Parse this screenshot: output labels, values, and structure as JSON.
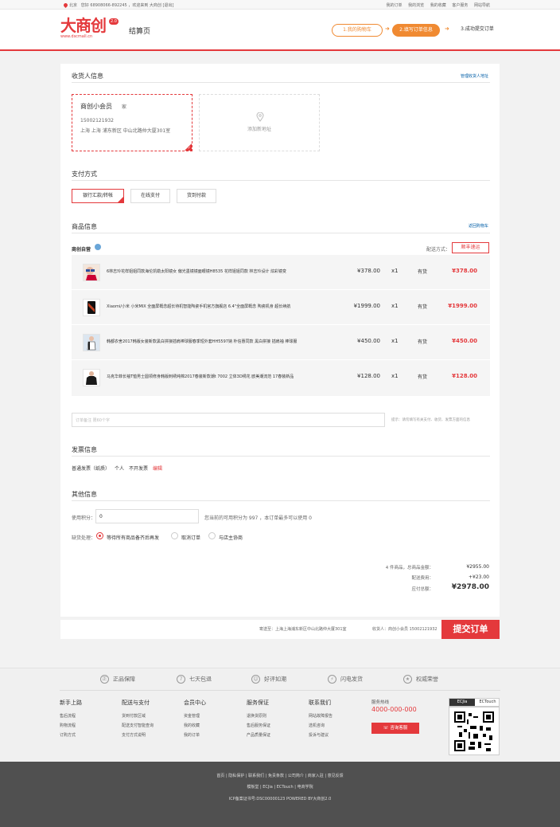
{
  "topbar": {
    "location": "北京",
    "greeting": "您好 68908066-892245 ，欢迎来到 大商创 [退出]",
    "links": [
      "我的订单",
      "我的浏览",
      "我的收藏",
      "客户服务",
      "网站导航"
    ]
  },
  "header": {
    "logo_text": "大商创",
    "logo_badge": "2.0",
    "logo_sub": "www.dscmall.cn",
    "page_title": "结算页",
    "steps": [
      "1.我的购物车",
      "2.填写订单信息",
      "3.成功提交订单"
    ]
  },
  "consignee": {
    "title": "收货人信息",
    "manage_link": "管理收货人地址",
    "name": "商创小会员",
    "tag": "家",
    "phone": "15002121932",
    "address": "上海 上海 浦东新区  中山北路仲大厦301室",
    "add_new": "添加新地址"
  },
  "payment": {
    "title": "支付方式",
    "options": [
      "银行汇款/转帐",
      "在线支付",
      "货到付款"
    ]
  },
  "goods": {
    "title": "商品信息",
    "back_link": "返回购物车",
    "shop_name": "商创自营",
    "shipping_label": "配送方式：",
    "shipping_value": "顺丰速运",
    "items": [
      {
        "name": "6林志玲花样姐姐同款海伦凯勒太阳镜女 偏光墨镜镜面眼镜H8535 花样姐姐同款 林志玲设计 炫彩镜变",
        "price": "¥378.00",
        "qty": "x1",
        "stock": "有货",
        "subtotal": "¥378.00"
      },
      {
        "name": "Xiaomi/小米 小米MIX 全面屏概念超长待机智能陶瓷手机官方旗舰店 6.4\"全面屏概念 陶瓷机身 超长续航",
        "price": "¥1999.00",
        "qty": "x1",
        "stock": "有货",
        "subtotal": "¥1999.00"
      },
      {
        "name": "韩都衣舍2017韩版女装新款黑白拼接插肩棒球服春季短外套HH5597妠 朴信惠同款 黑白拼接 插肩袖 棒球服",
        "price": "¥450.00",
        "qty": "x1",
        "stock": "有货",
        "subtotal": "¥450.00"
      },
      {
        "name": "马克华菲长袖T恤男士圆领修身韩版刺绣纯棉2017春装新款潮t 7002 立体3D绣花 欧美潮流范 17春装新品",
        "price": "¥128.00",
        "qty": "x1",
        "stock": "有货",
        "subtotal": "¥128.00"
      }
    ]
  },
  "remark": {
    "placeholder": "订单备注 限60个字",
    "hint": "提示：请勿填写有关支付、收货、发票方面的信息"
  },
  "invoice": {
    "title": "发票信息",
    "type": "普通发票（纸质）",
    "who": "个人",
    "content": "不开发票",
    "edit": "编辑"
  },
  "other": {
    "title": "其他信息",
    "points_label": "使用积分：",
    "points_value": "0",
    "points_hint": "您当前的可用积分为 997 ，本订单最多可以使用 0",
    "shortage_label": "缺货处理：",
    "shortage_options": [
      "等待所有商品备齐后再发",
      "取消订单",
      "与店主协商"
    ]
  },
  "summary": {
    "items_label": "4 件商品，总商品金额：",
    "items_value": "¥2955.00",
    "shipping_label": "配送费用：",
    "shipping_value": "+¥23.00",
    "total_label": "应付总额：",
    "total_value": "¥2978.00"
  },
  "submit": {
    "ship_to": "寄送至：上海上海浦东新区中山北路仲大厦301室",
    "receiver": "收货人：商创小会员  15002121932",
    "button": "提交订单"
  },
  "footer": {
    "assurances": [
      "正品保障",
      "七天包退",
      "好评如潮",
      "闪电发货",
      "权威荣誉"
    ],
    "columns": [
      {
        "title": "新手上路",
        "links": [
          "售后流程",
          "购物流程",
          "订购方式"
        ]
      },
      {
        "title": "配送与支付",
        "links": [
          "货到付款区域",
          "配送支付智能查询",
          "支付方式说明"
        ]
      },
      {
        "title": "会员中心",
        "links": [
          "资金管理",
          "我的收藏",
          "我的订单"
        ]
      },
      {
        "title": "服务保证",
        "links": [
          "退换货原则",
          "售后服务保证",
          "产品质量保证"
        ]
      },
      {
        "title": "联系我们",
        "links": [
          "网站故障报告",
          "选机咨询",
          "投诉与建议"
        ]
      }
    ],
    "hotline_label": "服务热线",
    "hotline": "4000-000-000",
    "service_button": "咨询客服",
    "qr_tabs": [
      "ECJia",
      "ECTouch"
    ],
    "bottom_links": "首页 | 隐私保护 | 联系我们 | 免责条款 | 公司简介 | 商家入驻 | 意见反馈",
    "bottom_links2": "模板堂 | ECJia | ECTouch | 电商学院",
    "icp": "ICP备案证书号:DSC00000123 POWERED BY大商创2.0"
  },
  "colors": {
    "accent": "#e4393c",
    "step": "#f08a32",
    "link": "#005ea7"
  }
}
